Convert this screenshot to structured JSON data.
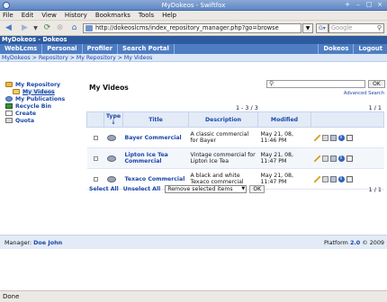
{
  "window": {
    "title": "MyDokeos - Swiftfox",
    "controls": [
      "+",
      "–",
      "□",
      "×"
    ]
  },
  "menu": [
    "File",
    "Edit",
    "View",
    "History",
    "Bookmarks",
    "Tools",
    "Help"
  ],
  "nav": {
    "url": "http://dokeoslcms/index_repository_manager.php?go=browse",
    "search_placeholder": "Google"
  },
  "site": {
    "header": "MyDokeos - Dokeos",
    "tabs": [
      "WebLcms",
      "Personal",
      "Profiler",
      "Search Portal"
    ],
    "right_tabs": [
      "Dokeos",
      "Logout"
    ],
    "breadcrumb": "MyDokeos > Repository > My Repository > My Videos"
  },
  "sidebar": {
    "items": [
      {
        "label": "My Repository",
        "icon": "folder-icon"
      },
      {
        "label": "My Videos",
        "icon": "folder-open-icon"
      },
      {
        "label": "My Publications",
        "icon": "publication-icon"
      },
      {
        "label": "Recycle Bin",
        "icon": "recycle-bin-icon"
      },
      {
        "label": "Create",
        "icon": "create-icon"
      },
      {
        "label": "Quota",
        "icon": "quota-icon"
      }
    ]
  },
  "main": {
    "title": "My Videos",
    "search_button": "OK",
    "advanced_search": "Advanced Search",
    "paging": "1 - 3 / 3",
    "page": "1 / 1",
    "columns": [
      "Type",
      "Title",
      "Description",
      "Modified"
    ],
    "rows": [
      {
        "title": "Bayer Commercial",
        "description": "A classic commercial for Bayer",
        "modified": "May 21, 08, 11:46 PM"
      },
      {
        "title": "Lipton Ice Tea Commercial",
        "description": "Vintage commercial for Lipton Ice Tea",
        "modified": "May 21, 08, 11:47 PM"
      },
      {
        "title": "Texaco Commercial",
        "description": "A black and white Texaco commercial",
        "modified": "May 21, 08, 11:47 PM"
      }
    ],
    "select_all": "Select All",
    "unselect_all": "Unselect All",
    "action_option": "Remove selected items",
    "action_ok": "OK",
    "page_bottom": "1 / 1"
  },
  "footer": {
    "manager_label": "Manager:",
    "manager_name": "Doe John",
    "platform_label": "Platform",
    "platform_version": "2.0",
    "platform_year": "© 2009"
  },
  "status": "Done"
}
